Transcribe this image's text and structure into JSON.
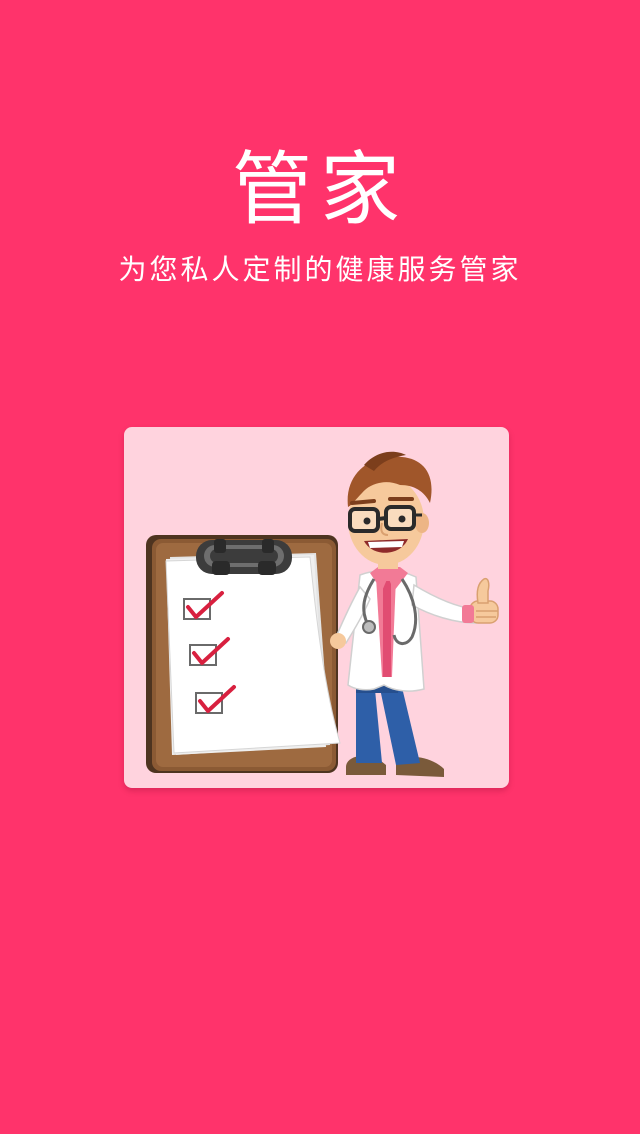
{
  "screen": {
    "title": "管家",
    "subtitle": "为您私人定制的健康服务管家"
  },
  "illustration": {
    "subject": "doctor-with-checklist",
    "icons": [
      "clipboard-icon",
      "checkbox-check-icon",
      "doctor-icon",
      "thumbs-up-icon",
      "stethoscope-icon"
    ]
  },
  "colors": {
    "background": "#FF336B",
    "card": "#FFD3DE",
    "text": "#FFFFFF",
    "check": "#D8203F"
  }
}
